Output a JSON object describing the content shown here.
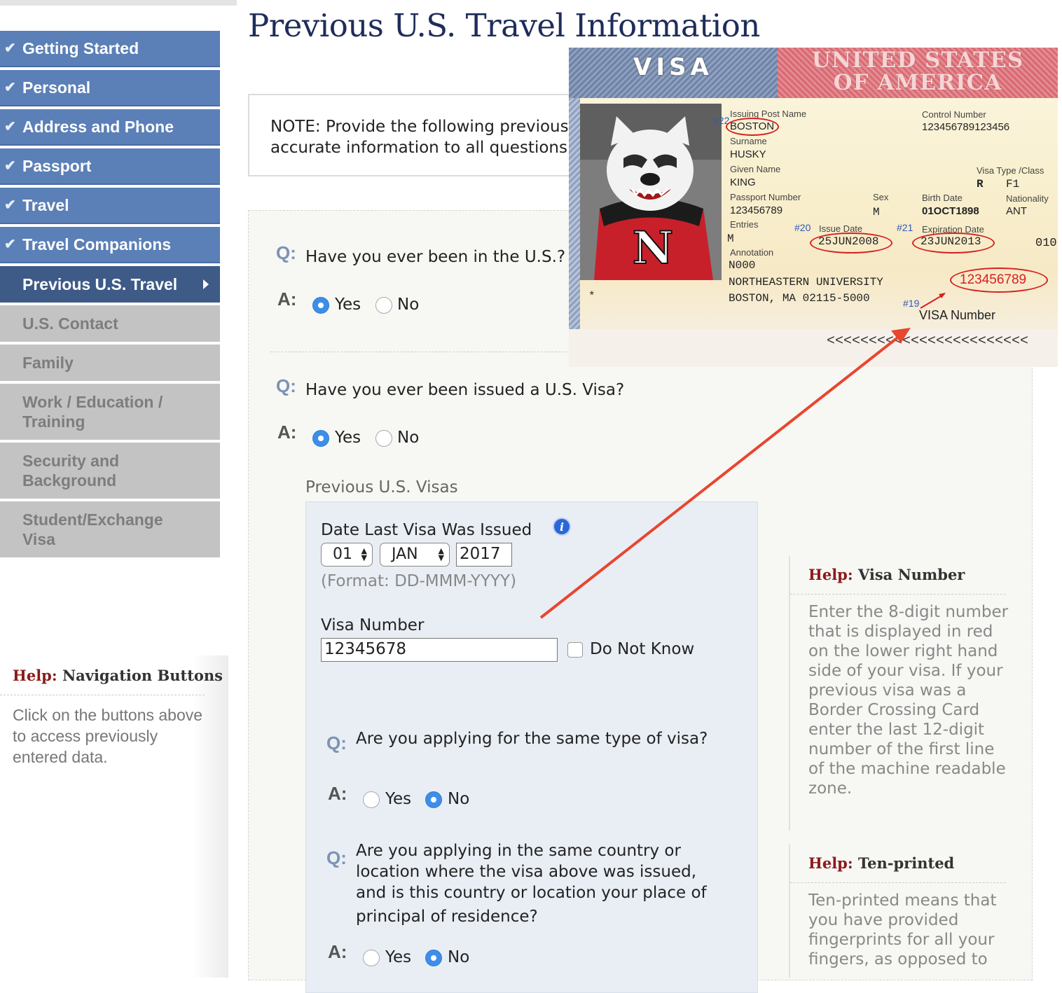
{
  "page": {
    "title": "Previous U.S. Travel Information"
  },
  "sidebar": {
    "items": [
      {
        "label": "Getting Started",
        "state": "complete"
      },
      {
        "label": "Personal",
        "state": "complete"
      },
      {
        "label": "Address and Phone",
        "state": "complete"
      },
      {
        "label": "Passport",
        "state": "complete"
      },
      {
        "label": "Travel",
        "state": "complete"
      },
      {
        "label": "Travel Companions",
        "state": "complete"
      },
      {
        "label": "Previous U.S. Travel",
        "state": "current"
      },
      {
        "label": "U.S. Contact",
        "state": "pending"
      },
      {
        "label": "Family",
        "state": "pending"
      },
      {
        "label": "Work / Education / Training",
        "state": "pending"
      },
      {
        "label": "Security and Background",
        "state": "pending"
      },
      {
        "label": "Student/Exchange Visa",
        "state": "pending"
      }
    ],
    "help": {
      "prefix": "Help:",
      "title": "Navigation Buttons",
      "text": "Click on the buttons above to access previously entered data."
    }
  },
  "note": {
    "line1": "NOTE: Provide the following previous",
    "line2": "accurate information to all questions"
  },
  "questions": {
    "q_label": "Q:",
    "a_label": "A:",
    "yes": "Yes",
    "no": "No",
    "been_in_us": {
      "text": "Have you ever been in the U.S.?",
      "answer": "Yes"
    },
    "issued_visa": {
      "text": "Have you ever been issued a U.S. Visa?",
      "answer": "Yes"
    }
  },
  "previous_visas": {
    "title": "Previous U.S. Visas",
    "date_label": "Date Last Visa Was Issued",
    "day": "01",
    "month": "JAN",
    "year": "2017",
    "format_hint": "(Format: DD-MMM-YYYY)",
    "visa_number_label": "Visa Number",
    "visa_number": "12345678",
    "do_not_know": "Do Not Know",
    "same_type": {
      "text": "Are you applying for the same type of visa?",
      "answer": "No"
    },
    "same_country": {
      "line1": "Are you applying in the same country or",
      "line2": "location where the visa above was issued,",
      "line3": "and is this country or location your place of",
      "line4": "principal of residence?",
      "answer": "No"
    }
  },
  "help_right": [
    {
      "prefix": "Help:",
      "title": "Visa Number",
      "text": "Enter the 8-digit number that is displayed in red on the lower right hand side of your visa. If your previous visa was a Border Crossing Card enter the last 12-digit number of the first line of the machine readable zone."
    },
    {
      "prefix": "Help:",
      "title": "Ten-printed",
      "text": "Ten-printed means that you have provided fingerprints for all your fingers, as opposed to"
    }
  ],
  "visa_image": {
    "header_left": "VISA",
    "header_right_1": "UNITED STATES",
    "header_right_2": "OF AMERICA",
    "issuing_post_label": "Issuing Post Name",
    "issuing_post": "BOSTON",
    "control_number_label": "Control Number",
    "control_number": "123456789123456",
    "surname_label": "Surname",
    "surname": "HUSKY",
    "given_name_label": "Given Name",
    "given_name": "KING",
    "visa_type_label": "Visa Type /Class",
    "visa_type": "R",
    "visa_class": "F1",
    "passport_number_label": "Passport Number",
    "passport_number": "123456789",
    "sex_label": "Sex",
    "sex": "M",
    "birth_date_label": "Birth Date",
    "birth_date": "01OCT1898",
    "nationality_label": "Nationality",
    "nationality": "ANT",
    "entries_label": "Entries",
    "entries": "M",
    "issue_date_label": "Issue Date",
    "issue_date": "25JUN2008",
    "expiration_date_label": "Expiration Date",
    "expiration_date": "23JUN2013",
    "annotation_label": "Annotation",
    "annotation_1": "N000",
    "annotation_2": "NORTHEASTERN UNIVERSITY",
    "annotation_3": "BOSTON, MA 02115-5000",
    "visa_number_red": "123456789",
    "visa_number_caption": "VISA Number",
    "marker_22": "#22",
    "marker_20": "#20",
    "marker_21": "#21",
    "marker_19": "#19",
    "right_edge": "010",
    "star": "*",
    "mrz": "<<<<<<<<<<<<<<<<<<<<<<<<",
    "mascot_letter": "N",
    "accent_red": "#d62020",
    "marker_blue": "#2f5bb7"
  },
  "colors": {
    "nav_complete": "#5b7fb7",
    "nav_current": "#3e5a87",
    "nav_pending": "#c3c3c3",
    "title_navy": "#1e2d5a",
    "help_red": "#8b1a1a",
    "radio_selected": "#3e8ee8",
    "arrow": "#e8462e"
  }
}
